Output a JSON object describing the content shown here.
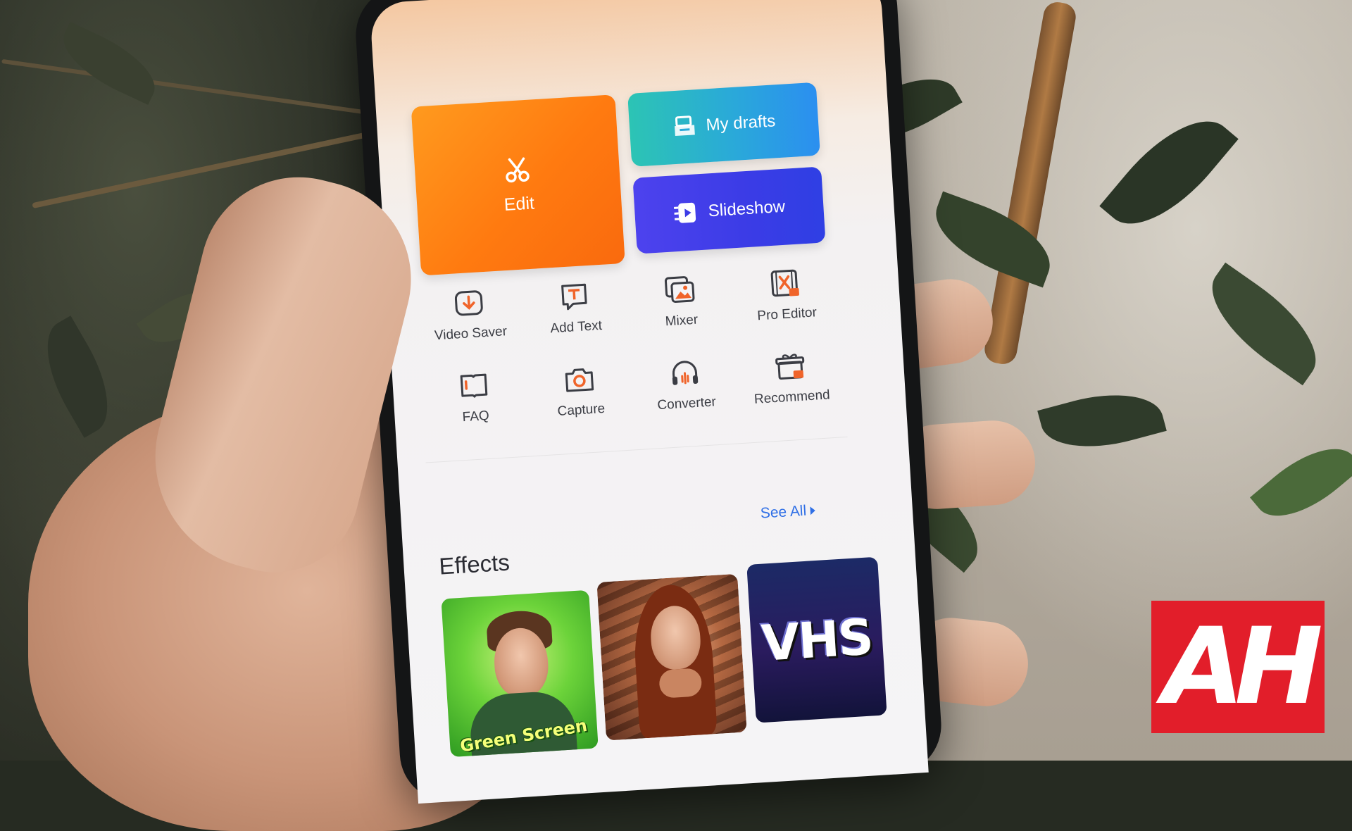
{
  "cards": {
    "edit_label": "Edit",
    "drafts_label": "My drafts",
    "slideshow_label": "Slideshow"
  },
  "tools": [
    {
      "label": "Video Saver",
      "icon": "download-icon"
    },
    {
      "label": "Add Text",
      "icon": "text-icon"
    },
    {
      "label": "Mixer",
      "icon": "image-stack-icon"
    },
    {
      "label": "Pro Editor",
      "icon": "film-scissors-icon"
    },
    {
      "label": "FAQ",
      "icon": "book-icon"
    },
    {
      "label": "Capture",
      "icon": "camera-icon"
    },
    {
      "label": "Converter",
      "icon": "headphones-icon"
    },
    {
      "label": "Recommend",
      "icon": "gift-icon"
    }
  ],
  "effects": {
    "title": "Effects",
    "see_all": "See All",
    "items": [
      {
        "label": "Green Screen"
      },
      {
        "label": ""
      },
      {
        "label": "VHS"
      }
    ]
  },
  "watermark": "AH",
  "colors": {
    "edit": "#ff7a10",
    "drafts": "#2aa9d9",
    "slideshow": "#3b3ce6",
    "icon_accent": "#f0642a",
    "link": "#2f6fe6",
    "logo": "#e21e2a"
  }
}
